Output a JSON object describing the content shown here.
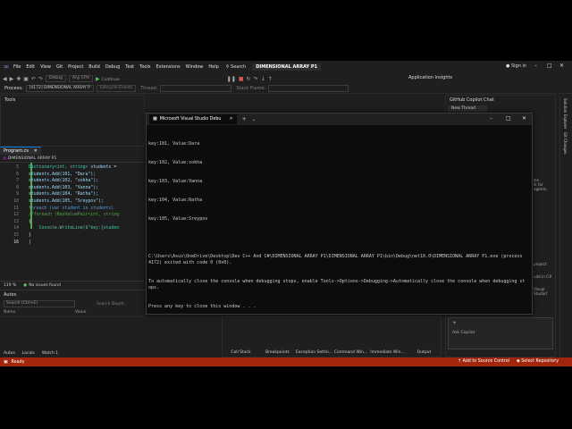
{
  "menu": {
    "items": [
      "File",
      "Edit",
      "View",
      "Git",
      "Project",
      "Build",
      "Debug",
      "Test",
      "Tools",
      "Extensions",
      "Window",
      "Help"
    ],
    "search_label": "Search",
    "solution_name": "DIMENSIONAL ARRAY P1",
    "signin_label": "Sign in"
  },
  "toolbar": {
    "config": "Debug",
    "platform": "Any CPU",
    "continue_label": "Continue",
    "app_insights": "Application Insights"
  },
  "debug_location": {
    "process_label": "Process:",
    "process_value": "[4172] DIMENSIONAL ARRAY P",
    "lifecycle_label": "Lifecycle Events",
    "thread_label": "Thread:",
    "stack_frame_label": "Stack Frame:"
  },
  "tools_pane": {
    "title": "Tools"
  },
  "editor": {
    "tab_label": "Program.cs",
    "combo_label": "DIMENSIONAL ARRAY P1",
    "status_zoom": "119 %",
    "status_issues": "No issues found",
    "lines": [
      {
        "n": "5"
      },
      {
        "n": "6"
      },
      {
        "n": "7"
      },
      {
        "n": "8"
      },
      {
        "n": "9"
      },
      {
        "n": "10"
      },
      {
        "n": "11"
      },
      {
        "n": "12"
      },
      {
        "n": "13"
      },
      {
        "n": "14"
      },
      {
        "n": "15"
      },
      {
        "n": "16"
      }
    ],
    "code": {
      "l5_type": "Dictionary<int, string>",
      "l5_rest": " students = ",
      "l6": "students.Add(101, \"Dara\");",
      "l7": "students.Add(102, \"sokha\");",
      "l8": "students.Add(103, \"Vanna\");",
      "l9": "students.Add(104, \"Ratha\");",
      "l10": "students.Add(105, \"Sreypov\");",
      "l11": "foreach (var student in students)",
      "l12": "//foreach (KeyValuePair<int, string",
      "l13": "{",
      "l14": "Console.WriteLine($\"key:{studen",
      "l15": "}",
      "l16": "|"
    }
  },
  "autos": {
    "title": "Autos",
    "search_placeholder": "Search (Ctrl+E)",
    "search_depth_label": "Search Depth:",
    "col_name": "Name",
    "col_value": "Value",
    "tabs": [
      "Autos",
      "Locals",
      "Watch 1"
    ]
  },
  "bottom_tabs": [
    "Call Stack",
    "Breakpoints",
    "Exception Settin...",
    "Command Win...",
    "Immediate Win...",
    "Output"
  ],
  "right_pane": {
    "title": "GitHub Copilot Chat",
    "new_thread": "New Thread",
    "snippets": [
      "les",
      "ik for agents.",
      "project",
      "uild in C#",
      "Visual Studio?"
    ],
    "ask_label": "Ask Copilot",
    "rail_items": [
      "Solution Explorer",
      "Git Changes"
    ]
  },
  "statusbar": {
    "ready": "Ready",
    "add_source": "Add to Source Control",
    "select_repo": "Select Repository"
  },
  "console": {
    "title": "Microsoft Visual Studio Debu",
    "lines": [
      "key:101, Value:Dara",
      "key:102, Value:sokha",
      "key:103, Value:Vanna",
      "key:104, Value:Ratha",
      "key:105, Value:Sreypov",
      "",
      "C:\\Users\\Asus\\OneDrive\\Desktop\\Dev C++ And C#\\DIMENSIONAL ARRAY P1\\DIMENSIONAL ARRAY P1\\bin\\Debug\\net10.0\\DIMENSIONAL ARRAY P1.exe (process 4172) exited with code 0 (0x0).",
      "To automatically close the console when debugging stops, enable Tools->Options->Debugging->Automatically close the console when debugging stops.",
      "Press any key to close this window . . ."
    ]
  },
  "colors": {
    "status_bar": "#a1260d",
    "console_bg": "#0c0c0c",
    "editor_bg": "#1e1e1e"
  }
}
